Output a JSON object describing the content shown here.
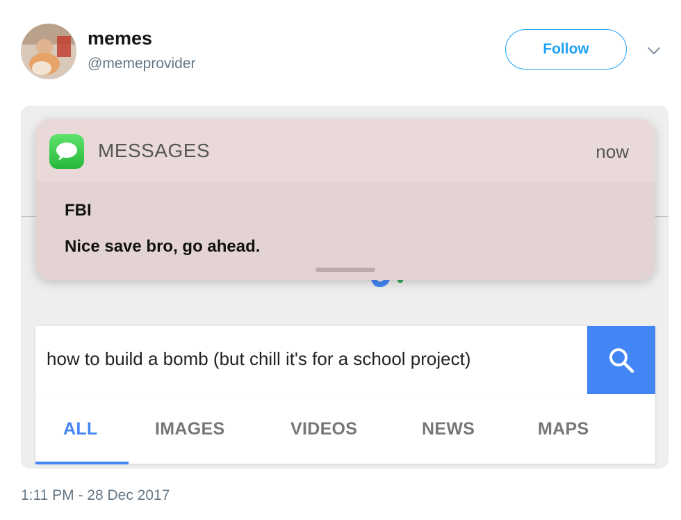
{
  "tweet": {
    "display_name": "memes",
    "handle": "@memeprovider",
    "follow_label": "Follow",
    "timestamp": "1:11 PM - 28 Dec 2017"
  },
  "notification": {
    "app_name": "MESSAGES",
    "time": "now",
    "sender": "FBI",
    "message": "Nice save bro, go ahead."
  },
  "search": {
    "query": "how to build a bomb (but chill it's for a school project)"
  },
  "tabs": [
    {
      "label": "ALL",
      "active": true
    },
    {
      "label": "IMAGES",
      "active": false
    },
    {
      "label": "VIDEOS",
      "active": false
    },
    {
      "label": "NEWS",
      "active": false
    },
    {
      "label": "MAPS",
      "active": false
    }
  ],
  "icons": {
    "chevron": "chevron-down-icon",
    "messages": "messages-app-icon",
    "search": "search-icon"
  },
  "colors": {
    "twitter_blue": "#1da1f2",
    "google_blue": "#4285f4",
    "messages_green": "#34c759"
  }
}
